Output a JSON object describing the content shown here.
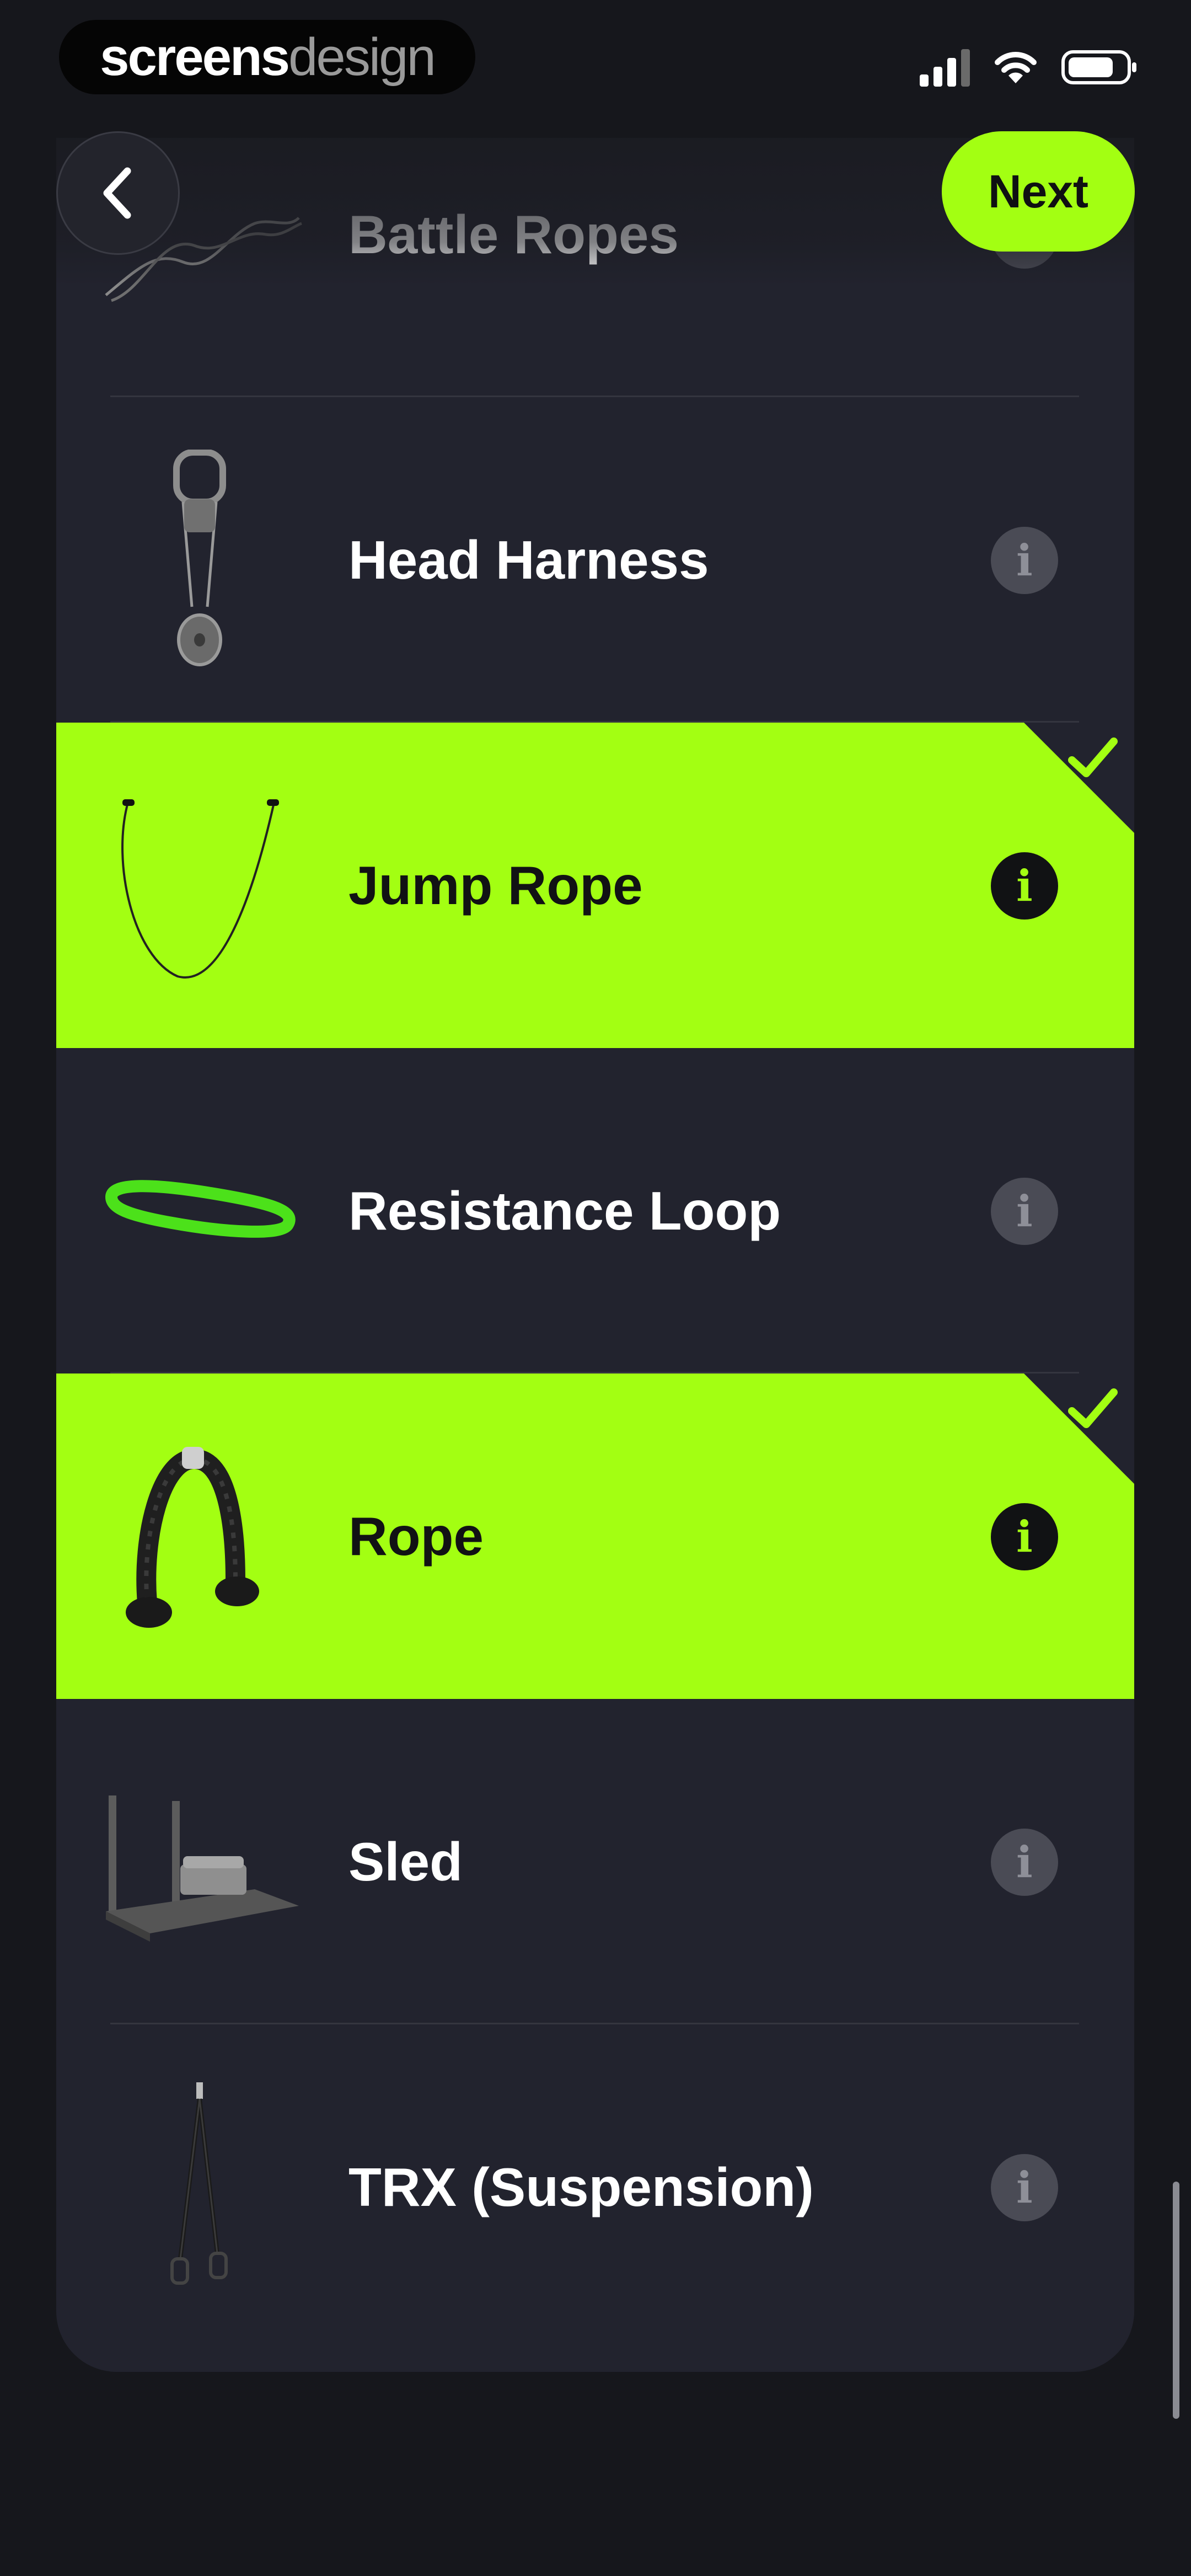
{
  "status_bar": {
    "brand_part1": "screens",
    "brand_part2": "design",
    "icons": [
      "cellular-signal-icon",
      "wifi-icon",
      "battery-icon"
    ]
  },
  "nav": {
    "back_icon": "chevron-left-icon",
    "next_label": "Next"
  },
  "colors": {
    "accent": "#a3ff12",
    "background": "#16171c",
    "card": "#22232e"
  },
  "equipment": [
    {
      "label": "Battle Ropes",
      "icon": "battle-ropes-image",
      "selected": false
    },
    {
      "label": "Head Harness",
      "icon": "head-harness-image",
      "selected": false
    },
    {
      "label": "Jump Rope",
      "icon": "jump-rope-image",
      "selected": true
    },
    {
      "label": "Resistance Loop",
      "icon": "resistance-loop-image",
      "selected": false
    },
    {
      "label": "Rope",
      "icon": "tricep-rope-image",
      "selected": true
    },
    {
      "label": "Sled",
      "icon": "sled-image",
      "selected": false
    },
    {
      "label": "TRX (Suspension)",
      "icon": "trx-suspension-image",
      "selected": false
    }
  ],
  "info_glyph": "i"
}
